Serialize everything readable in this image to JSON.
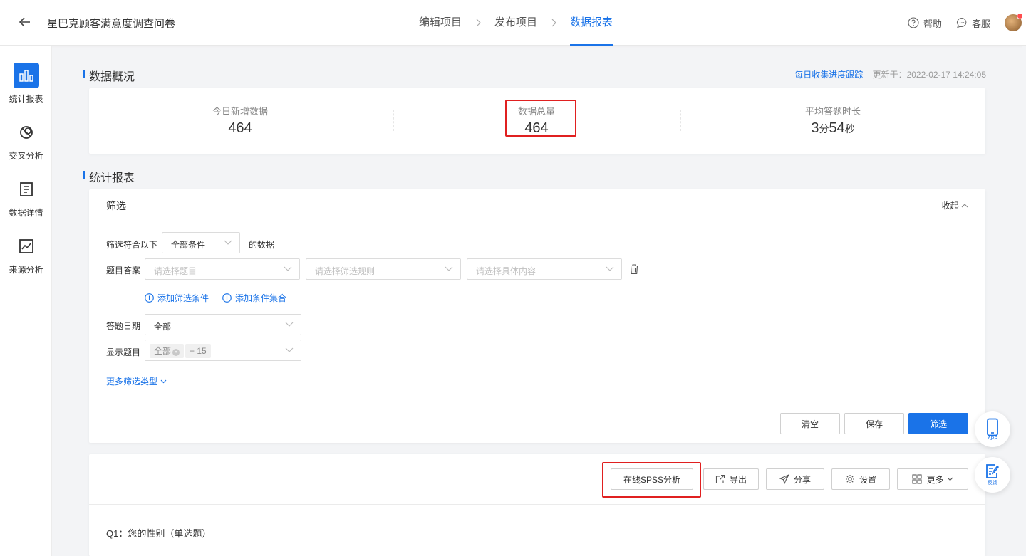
{
  "header": {
    "title": "星巴克顾客满意度调查问卷",
    "steps": [
      "编辑项目",
      "发布项目",
      "数据报表"
    ],
    "help": "帮助",
    "service": "客服"
  },
  "sidebar": {
    "items": [
      {
        "label": "统计报表",
        "icon": "bar-chart-icon"
      },
      {
        "label": "交叉分析",
        "icon": "cross-analysis-icon"
      },
      {
        "label": "数据详情",
        "icon": "document-icon"
      },
      {
        "label": "来源分析",
        "icon": "trend-chart-icon"
      }
    ]
  },
  "overview": {
    "title": "数据概况",
    "track_link": "每日收集进度跟踪",
    "updated": "更新于：2022-02-17 14:24:05",
    "stats": [
      {
        "label": "今日新增数据",
        "value": "464"
      },
      {
        "label": "数据总量",
        "value": "464"
      },
      {
        "label": "平均答题时长",
        "min": "3",
        "min_unit": "分",
        "sec": "54",
        "sec_unit": "秒"
      }
    ]
  },
  "report": {
    "title": "统计报表"
  },
  "filter": {
    "title": "筛选",
    "collapse": "收起",
    "match_prefix": "筛选符合以下",
    "match_value": "全部条件",
    "match_suffix": "的数据",
    "answer_label": "题目答案",
    "ph_question": "请选择题目",
    "ph_rule": "请选择筛选规则",
    "ph_content": "请选择具体内容",
    "add_condition": "添加筛选条件",
    "add_group": "添加条件集合",
    "date_label": "答题日期",
    "date_value": "全部",
    "show_label": "显示题目",
    "show_tag": "全部",
    "show_more": "+ 15",
    "more_types": "更多筛选类型",
    "btn_clear": "清空",
    "btn_save": "保存",
    "btn_filter": "筛选"
  },
  "toolbar": {
    "spss": "在线SPSS分析",
    "export": "导出",
    "share": "分享",
    "settings": "设置",
    "more": "更多"
  },
  "question": {
    "q1": "Q1：您的性别（单选题）"
  },
  "float": {
    "app": "APP",
    "feedback": "反馈"
  },
  "colors": {
    "accent": "#1a73e8",
    "highlight": "#e02020"
  }
}
